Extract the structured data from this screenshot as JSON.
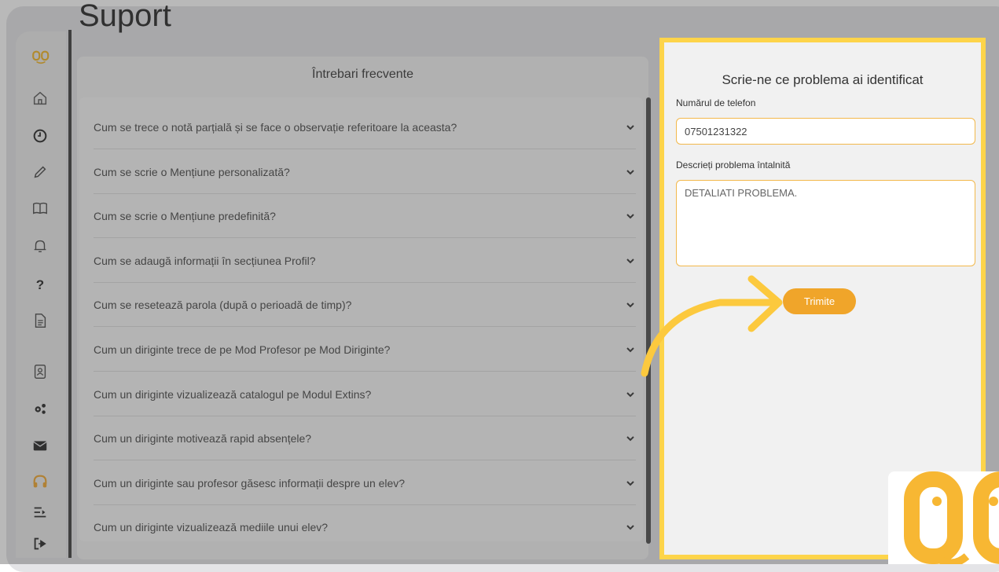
{
  "page": {
    "title": "Suport"
  },
  "sidebar": {
    "items": [
      {
        "name": "home",
        "icon": "home-icon"
      },
      {
        "name": "history",
        "icon": "clock-icon"
      },
      {
        "name": "edit",
        "icon": "pencil-icon"
      },
      {
        "name": "catalog",
        "icon": "book-icon"
      },
      {
        "name": "notifications",
        "icon": "bell-icon"
      },
      {
        "name": "help",
        "icon": "question-icon",
        "label": "?"
      },
      {
        "name": "documents",
        "icon": "document-icon"
      },
      {
        "name": "contacts",
        "icon": "contact-book-icon"
      },
      {
        "name": "settings",
        "icon": "gears-icon"
      },
      {
        "name": "messages",
        "icon": "envelope-icon"
      },
      {
        "name": "support",
        "icon": "headphones-icon"
      },
      {
        "name": "collapse",
        "icon": "menu-arrow-icon"
      },
      {
        "name": "logout",
        "icon": "logout-icon"
      }
    ]
  },
  "faq": {
    "title": "Întrebari frecvente",
    "items": [
      "Cum se trece o notă parțială și se face o observație referitoare la aceasta?",
      "Cum se scrie o Mențiune personalizată?",
      "Cum se scrie o Mențiune predefinită?",
      "Cum se adaugă informații în secțiunea Profil?",
      "Cum se resetează parola (după o perioadă de timp)?",
      "Cum un diriginte trece de pe Mod Profesor pe Mod Diriginte?",
      "Cum un diriginte vizualizează catalogul pe Modul Extins?",
      "Cum un diriginte motivează rapid absențele?",
      "Cum un diriginte sau profesor găsesc informații despre un elev?",
      "Cum un diriginte vizualizează mediile unui elev?"
    ]
  },
  "form": {
    "title": "Scrie-ne ce problema ai identificat",
    "phone_label": "Numărul de telefon",
    "phone_value": "07501231322",
    "desc_label": "Descrieți problema întalnită",
    "desc_value": "DETALIATI PROBLEMA.",
    "submit_label": "Trimite"
  },
  "colors": {
    "accent": "#f0a52a",
    "highlight": "#fdd44a",
    "logo": "#f7b733"
  }
}
